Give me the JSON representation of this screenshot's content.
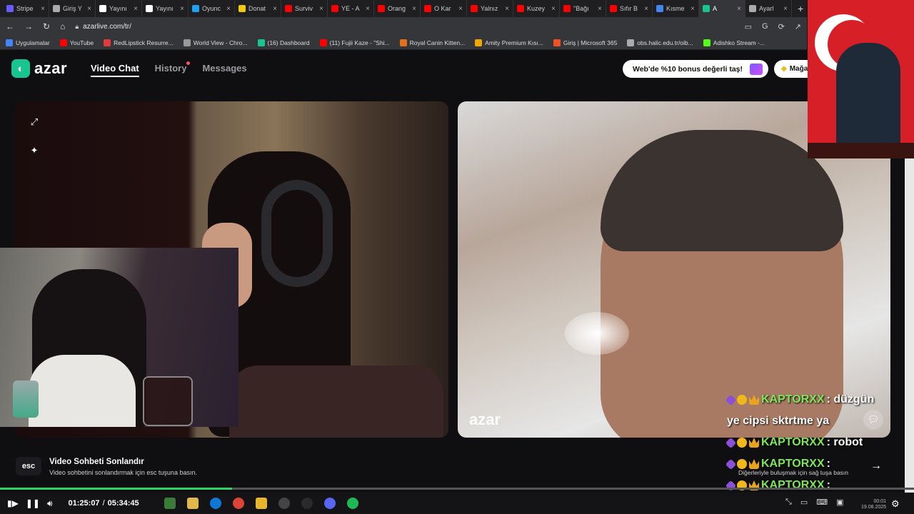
{
  "browser": {
    "tabs": [
      {
        "label": "Stripe",
        "color": "#6b5bff"
      },
      {
        "label": "Giriş Y",
        "color": "#aaaaaa"
      },
      {
        "label": "Yayını",
        "color": "#ffffff"
      },
      {
        "label": "Yayını",
        "color": "#ffffff"
      },
      {
        "label": "Oyunc",
        "color": "#1da1f2"
      },
      {
        "label": "Donat",
        "color": "#f2c811"
      },
      {
        "label": "Surviv",
        "color": "#ff0000"
      },
      {
        "label": "YE - A",
        "color": "#ff0000"
      },
      {
        "label": "Orang",
        "color": "#ff0000"
      },
      {
        "label": "O Kar",
        "color": "#ff0000"
      },
      {
        "label": "Yalnız",
        "color": "#ff0000"
      },
      {
        "label": "Kuzey",
        "color": "#ff0000"
      },
      {
        "label": "\"Bağı",
        "color": "#ff0000"
      },
      {
        "label": "Sıfır B",
        "color": "#ff0000"
      },
      {
        "label": "Kısmе",
        "color": "#4285f4"
      },
      {
        "label": "A",
        "color": "#18c58f",
        "active": true
      },
      {
        "label": "Ayarl",
        "color": "#aaaaaa"
      }
    ],
    "url": "azarlive.com/tr/",
    "bookmarks": [
      {
        "label": "Uygulamalar",
        "color": "#4285f4"
      },
      {
        "label": "YouTube",
        "color": "#ff0000"
      },
      {
        "label": "RedLipstick Resurre...",
        "color": "#e23b3b"
      },
      {
        "label": "World View - Chro...",
        "color": "#999999"
      },
      {
        "label": "(16) Dashboard",
        "color": "#18c58f"
      },
      {
        "label": "(11) Fujii Kaze - \"Shi...",
        "color": "#ff0000"
      },
      {
        "label": "Royal Canin Kitten...",
        "color": "#e2711d"
      },
      {
        "label": "Amity Premium Kısı...",
        "color": "#f2a600"
      },
      {
        "label": "Giriş | Microsoft 365",
        "color": "#f25022"
      },
      {
        "label": "obs.halic.edu.tr/oib...",
        "color": "#aaaaaa"
      },
      {
        "label": "Adishko Stream -...",
        "color": "#53fc18"
      }
    ]
  },
  "azar": {
    "logo_text": "azar",
    "nav": [
      {
        "label": "Video Chat",
        "active": true
      },
      {
        "label": "History",
        "dot": true
      },
      {
        "label": "Messages"
      }
    ],
    "promo_label": "Web'de %10 bonus değerli taş!",
    "shop_label": "Mağa",
    "watermark": "azar"
  },
  "chat": [
    {
      "user": "KAPTORXX",
      "message": ": düzgün"
    },
    {
      "user": "",
      "message": "ye cipsi sktrtme ya"
    },
    {
      "user": "KAPTORXX",
      "message": ": robot"
    },
    {
      "user": "KAPTORXX",
      "message": ":"
    },
    {
      "user": "KAPTORXX",
      "message": ":"
    }
  ],
  "footer": {
    "esc_key": "esc",
    "end_title": "Video Sohbeti Sonlandır",
    "end_sub": "Video sohbetini sonlandırmak için esc tuşuna basın.",
    "match_sub": "Diğerleriyle buluşmak için sağ tuşa basın"
  },
  "player": {
    "current_time": "01:25:07",
    "separator": "/",
    "total_time": "05:34:45",
    "progress": 0.254
  },
  "system": {
    "clock_time": "00:01",
    "clock_date": "19.08.2025"
  },
  "colors": {
    "accent": "#18c58f",
    "chat_username": "#7ee65a",
    "progress_fill": "#2dd36a"
  }
}
